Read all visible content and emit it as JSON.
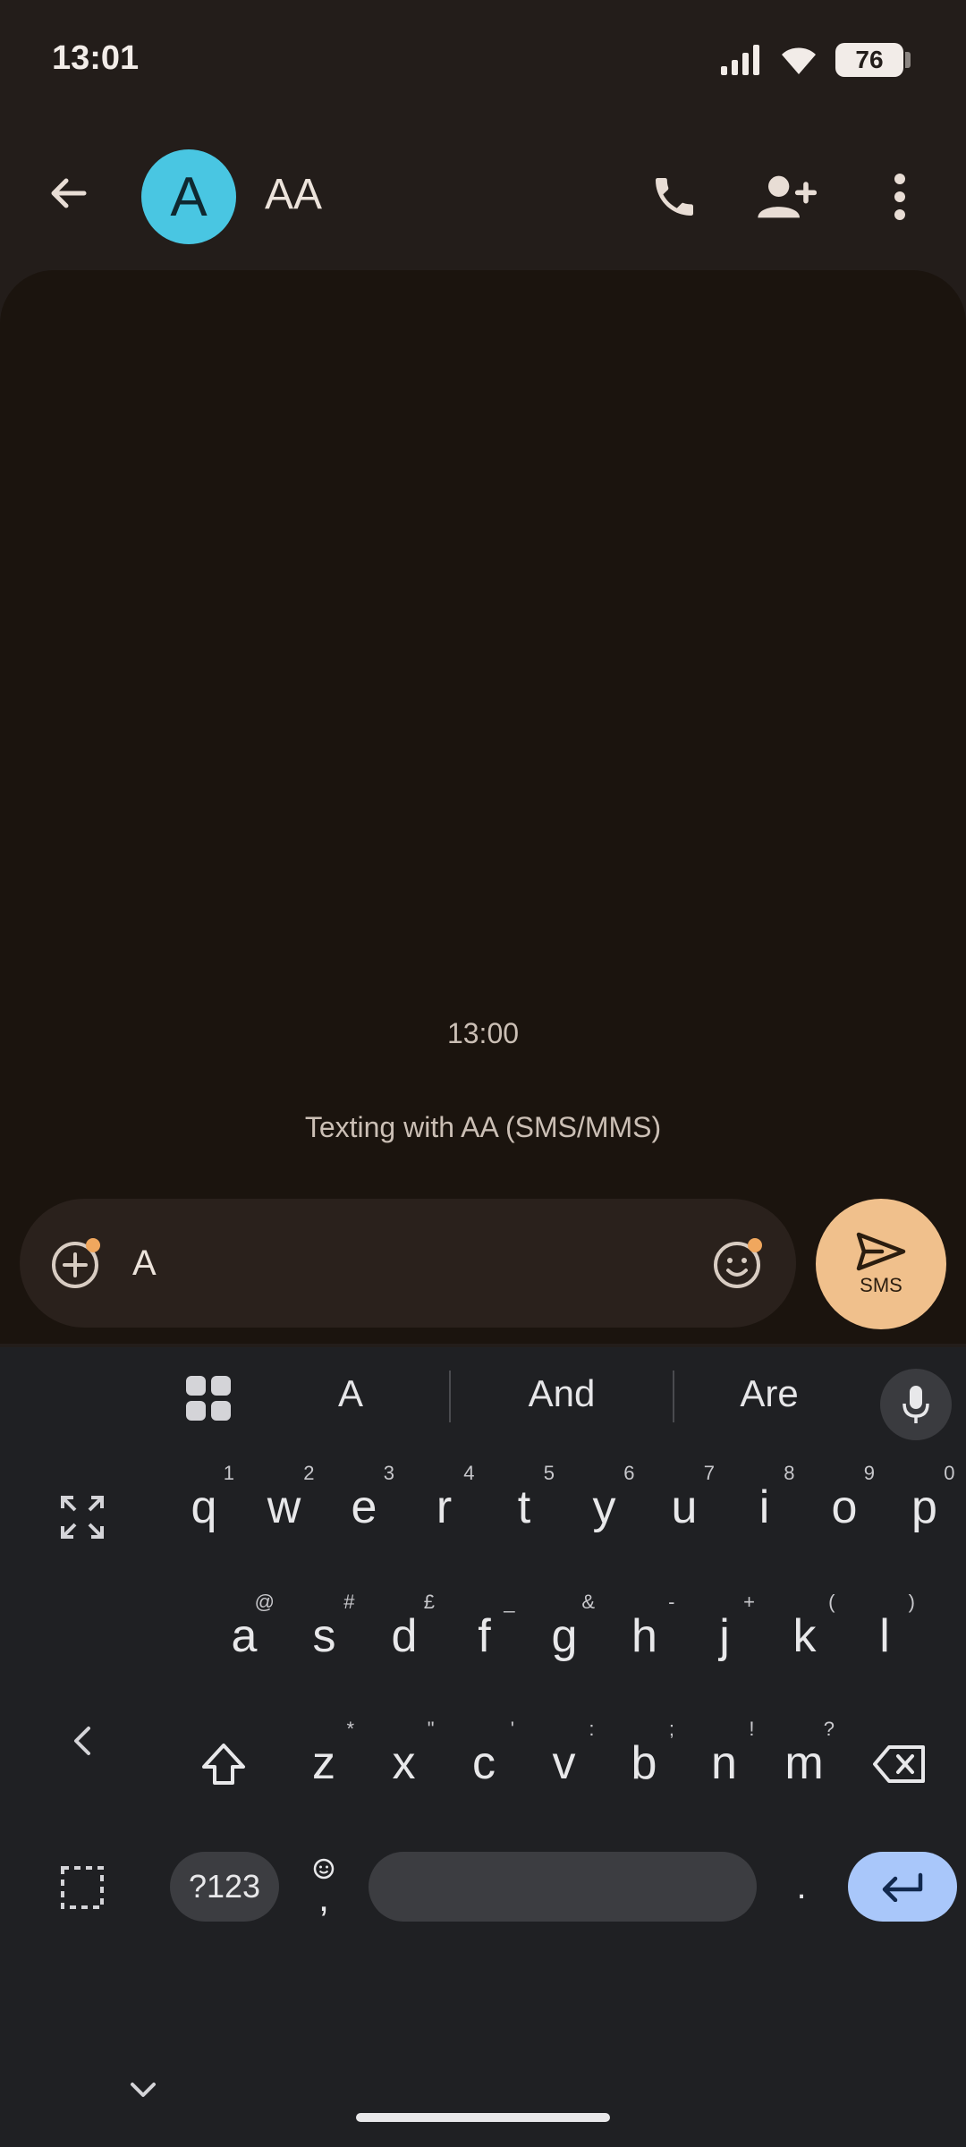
{
  "status": {
    "time": "13:01",
    "battery": "76"
  },
  "header": {
    "avatar_letter": "A",
    "contact_name": "AA"
  },
  "conversation": {
    "timestamp": "13:00",
    "note": "Texting with AA (SMS/MMS)"
  },
  "compose": {
    "text": "A",
    "send_label": "SMS"
  },
  "keyboard": {
    "suggestions": [
      "A",
      "And",
      "Are"
    ],
    "row1": [
      {
        "k": "q",
        "h": "1"
      },
      {
        "k": "w",
        "h": "2"
      },
      {
        "k": "e",
        "h": "3"
      },
      {
        "k": "r",
        "h": "4"
      },
      {
        "k": "t",
        "h": "5"
      },
      {
        "k": "y",
        "h": "6"
      },
      {
        "k": "u",
        "h": "7"
      },
      {
        "k": "i",
        "h": "8"
      },
      {
        "k": "o",
        "h": "9"
      },
      {
        "k": "p",
        "h": "0"
      }
    ],
    "row2": [
      {
        "k": "a",
        "h": "@"
      },
      {
        "k": "s",
        "h": "#"
      },
      {
        "k": "d",
        "h": "£"
      },
      {
        "k": "f",
        "h": "_"
      },
      {
        "k": "g",
        "h": "&"
      },
      {
        "k": "h",
        "h": "-"
      },
      {
        "k": "j",
        "h": "+"
      },
      {
        "k": "k",
        "h": "("
      },
      {
        "k": "l",
        "h": ")"
      }
    ],
    "row3": [
      {
        "k": "z",
        "h": "*"
      },
      {
        "k": "x",
        "h": "\""
      },
      {
        "k": "c",
        "h": "'"
      },
      {
        "k": "v",
        "h": ":"
      },
      {
        "k": "b",
        "h": ";"
      },
      {
        "k": "n",
        "h": "!"
      },
      {
        "k": "m",
        "h": "?"
      }
    ],
    "num_label": "?123",
    "comma": ",",
    "period": "."
  }
}
